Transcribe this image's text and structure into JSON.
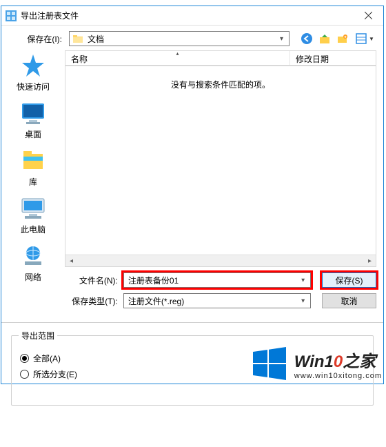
{
  "titlebar": {
    "title": "导出注册表文件"
  },
  "savein": {
    "label": "保存在(I):",
    "folder": "文档"
  },
  "sidebar": {
    "items": [
      {
        "label": "快速访问"
      },
      {
        "label": "桌面"
      },
      {
        "label": "库"
      },
      {
        "label": "此电脑"
      },
      {
        "label": "网络"
      }
    ]
  },
  "list": {
    "columns": {
      "name": "名称",
      "date": "修改日期"
    },
    "empty_msg": "没有与搜索条件匹配的项。"
  },
  "filename": {
    "label": "文件名(N):",
    "value": "注册表备份01"
  },
  "filetype": {
    "label": "保存类型(T):",
    "value": "注册文件(*.reg)"
  },
  "buttons": {
    "save": "保存(S)",
    "cancel": "取消"
  },
  "export": {
    "group": "导出范围",
    "all": "全部(A)",
    "branch": "所选分支(E)"
  },
  "watermark": {
    "brand_pre": "Win1",
    "brand_o": "0",
    "brand_post": "之家",
    "url": "www.win10xitong.com"
  }
}
